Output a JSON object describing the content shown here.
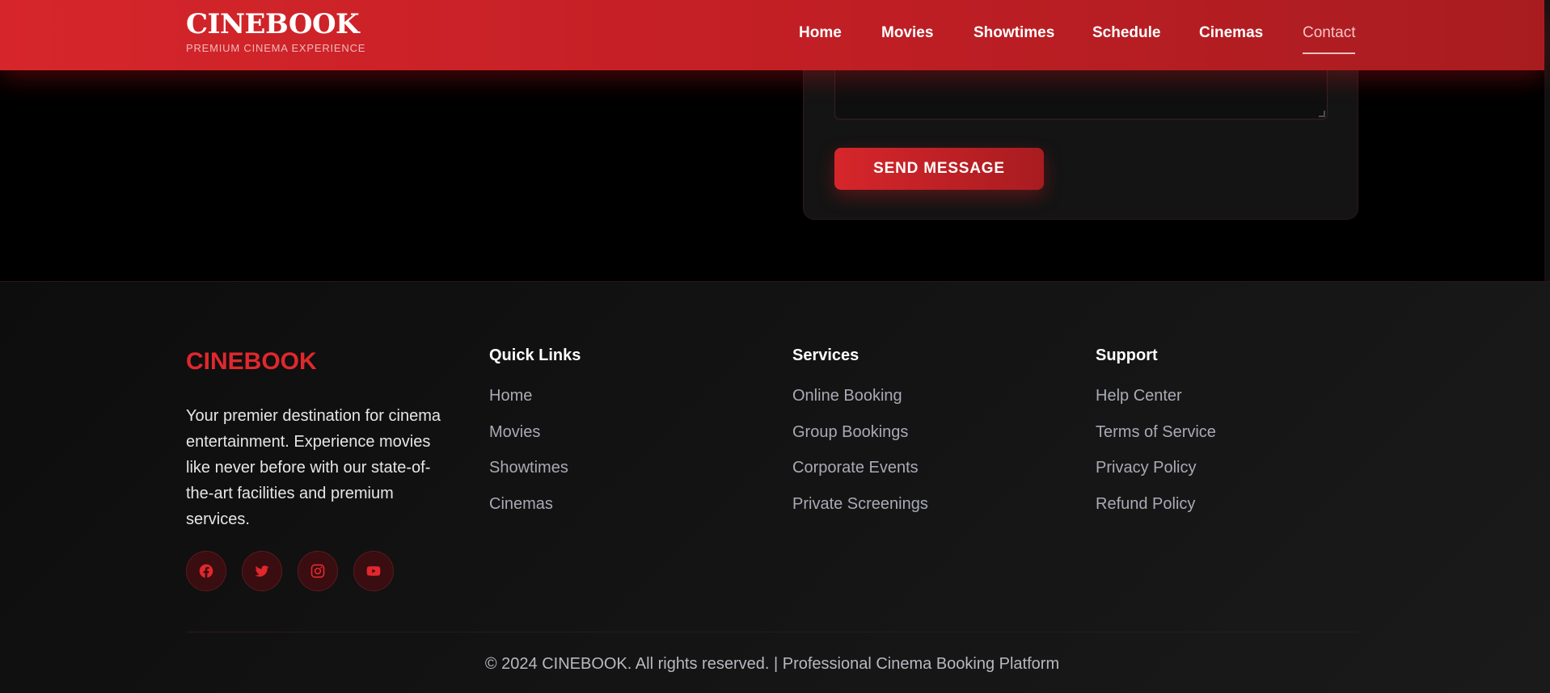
{
  "nav": {
    "brand": "CINEBOOK",
    "tagline": "PREMIUM CINEMA EXPERIENCE",
    "links": [
      "Home",
      "Movies",
      "Showtimes",
      "Schedule",
      "Cinemas",
      "Contact"
    ],
    "active": "Contact"
  },
  "form": {
    "submit_label": "SEND MESSAGE"
  },
  "footer": {
    "brand": "CINEBOOK",
    "description": "Your premier destination for cinema entertainment. Experience movies like never before with our state-of-the-art facilities and premium services.",
    "socials": [
      "facebook-icon",
      "twitter-icon",
      "instagram-icon",
      "youtube-icon"
    ],
    "columns": [
      {
        "title": "Quick Links",
        "links": [
          "Home",
          "Movies",
          "Showtimes",
          "Cinemas"
        ]
      },
      {
        "title": "Services",
        "links": [
          "Online Booking",
          "Group Bookings",
          "Corporate Events",
          "Private Screenings"
        ]
      },
      {
        "title": "Support",
        "links": [
          "Help Center",
          "Terms of Service",
          "Privacy Policy",
          "Refund Policy"
        ]
      }
    ],
    "copyright": "© 2024 CINEBOOK. All rights reserved. | Professional Cinema Booking Platform"
  },
  "colors": {
    "accent": "#d6262b",
    "background": "#000000",
    "footer_link": "#a9aab5"
  }
}
